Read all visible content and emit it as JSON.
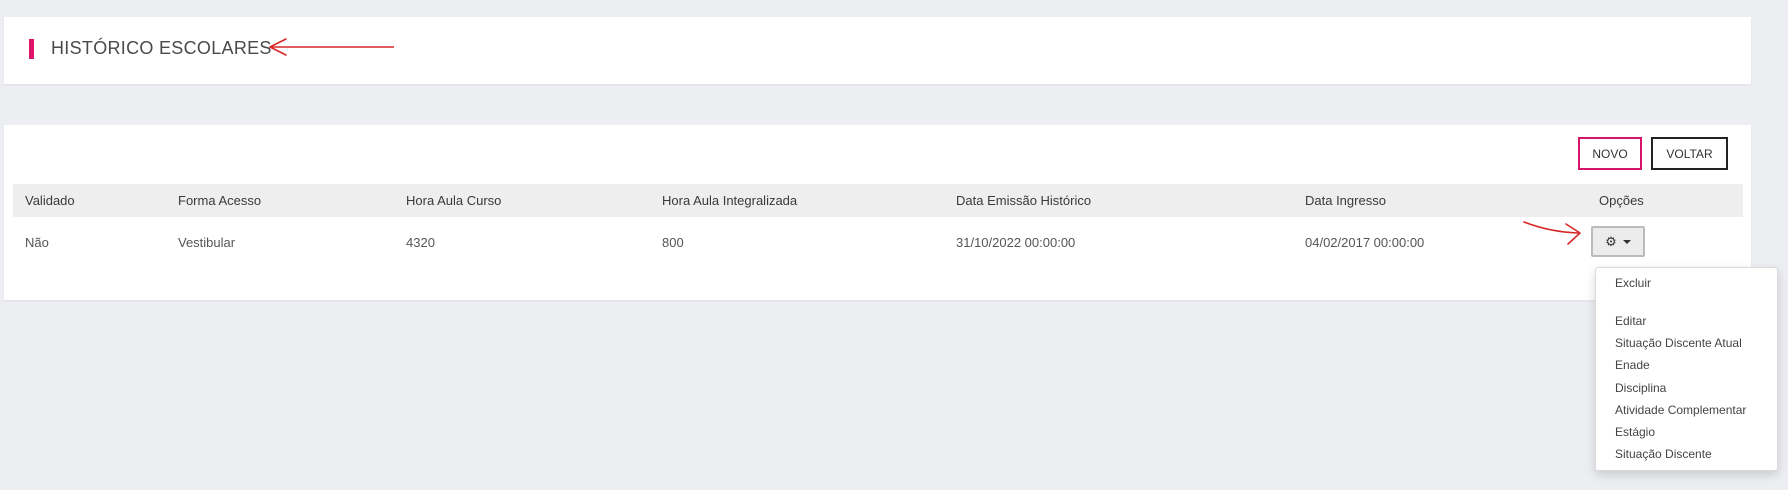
{
  "header": {
    "title": "HISTÓRICO ESCOLARES"
  },
  "toolbar": {
    "novo_label": "NOVO",
    "voltar_label": "VOLTAR"
  },
  "table": {
    "columns": [
      "Validado",
      "Forma Acesso",
      "Hora Aula Curso",
      "Hora Aula Integralizada",
      "Data Emissão Histórico",
      "Data Ingresso",
      "Opções"
    ],
    "rows": [
      {
        "validado": "Não",
        "forma_acesso": "Vestibular",
        "hora_aula_curso": "4320",
        "hora_aula_integralizada": "800",
        "data_emissao": "31/10/2022 00:00:00",
        "data_ingresso": "04/02/2017 00:00:00"
      }
    ]
  },
  "options_button": {
    "icon": "gear-icon",
    "caret": "caret-down-icon"
  },
  "options_menu": {
    "items": [
      "Excluir",
      "Editar",
      "Situação Discente Atual",
      "Enade",
      "Disciplina",
      "Atividade Complementar",
      "Estágio",
      "Situação Discente"
    ]
  },
  "colors": {
    "accent": "#e0136b",
    "annotation": "#d62828",
    "background": "#eceef2"
  }
}
